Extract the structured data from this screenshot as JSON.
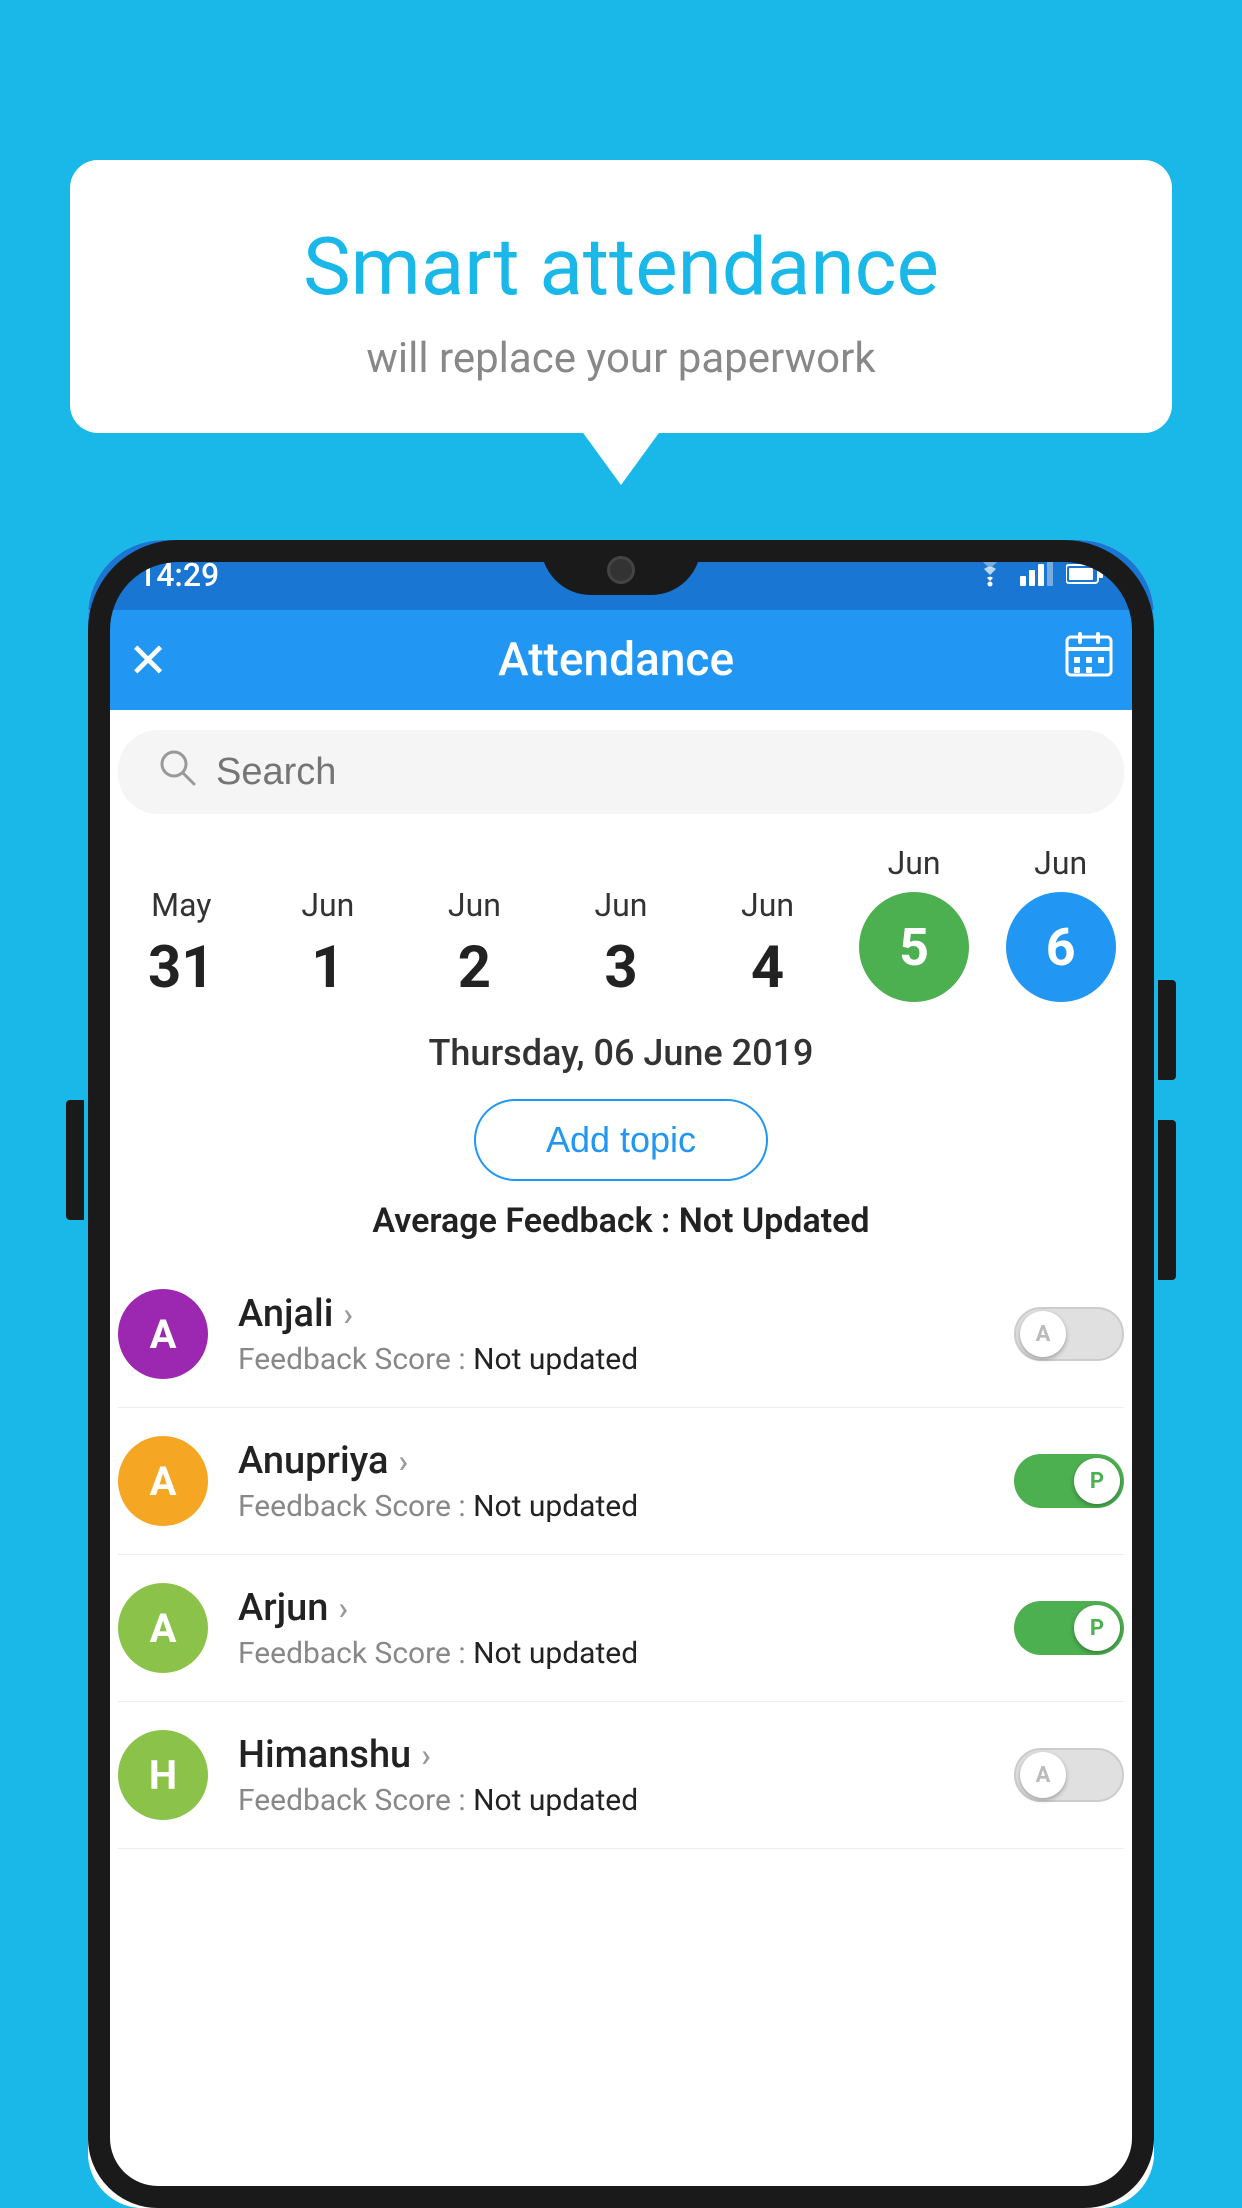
{
  "background_color": "#1ab8e8",
  "speech_bubble": {
    "title": "Smart attendance",
    "subtitle": "will replace your paperwork"
  },
  "status_bar": {
    "time": "14:29",
    "icons": [
      "wifi",
      "signal",
      "battery"
    ]
  },
  "app_bar": {
    "title": "Attendance",
    "close_icon": "✕",
    "calendar_icon": "📅"
  },
  "search": {
    "placeholder": "Search"
  },
  "calendar": {
    "days": [
      {
        "month": "May",
        "date": "31",
        "state": "normal"
      },
      {
        "month": "Jun",
        "date": "1",
        "state": "normal"
      },
      {
        "month": "Jun",
        "date": "2",
        "state": "normal"
      },
      {
        "month": "Jun",
        "date": "3",
        "state": "normal"
      },
      {
        "month": "Jun",
        "date": "4",
        "state": "normal"
      },
      {
        "month": "Jun",
        "date": "5",
        "state": "active-green"
      },
      {
        "month": "Jun",
        "date": "6",
        "state": "active-blue"
      }
    ]
  },
  "selected_date": "Thursday, 06 June 2019",
  "add_topic_label": "Add topic",
  "avg_feedback_label": "Average Feedback :",
  "avg_feedback_value": "Not Updated",
  "students": [
    {
      "name": "Anjali",
      "avatar_letter": "A",
      "avatar_color": "#9c27b0",
      "feedback_label": "Feedback Score :",
      "feedback_value": "Not updated",
      "toggle_state": "off",
      "toggle_letter": "A"
    },
    {
      "name": "Anupriya",
      "avatar_letter": "A",
      "avatar_color": "#f5a623",
      "feedback_label": "Feedback Score :",
      "feedback_value": "Not updated",
      "toggle_state": "on-green",
      "toggle_letter": "P"
    },
    {
      "name": "Arjun",
      "avatar_letter": "A",
      "avatar_color": "#8bc34a",
      "feedback_label": "Feedback Score :",
      "feedback_value": "Not updated",
      "toggle_state": "on-green",
      "toggle_letter": "P"
    },
    {
      "name": "Himanshu",
      "avatar_letter": "H",
      "avatar_color": "#8bc34a",
      "feedback_label": "Feedback Score :",
      "feedback_value": "Not updated",
      "toggle_state": "off",
      "toggle_letter": "A"
    }
  ]
}
